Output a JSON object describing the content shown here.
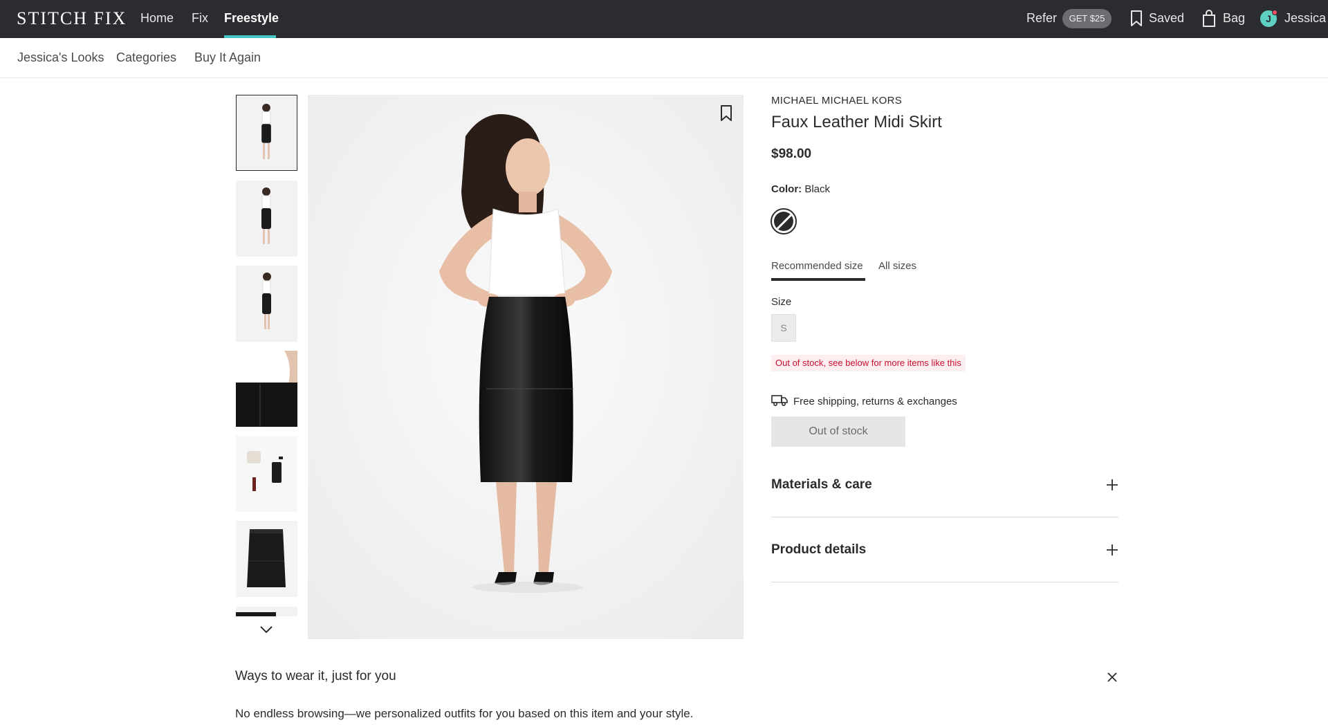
{
  "topnav": {
    "logo": "STITCH FIX",
    "links": [
      "Home",
      "Fix",
      "Freestyle"
    ],
    "active_link": "Freestyle",
    "refer_label": "Refer",
    "refer_badge": "GET $25",
    "saved_label": "Saved",
    "bag_label": "Bag",
    "user_initial": "J",
    "user_name": "Jessica"
  },
  "subnav": {
    "links": [
      "Jessica's Looks",
      "Categories",
      "Buy It Again"
    ]
  },
  "gallery": {
    "thumbnail_count": 6,
    "selected_index": 0
  },
  "product": {
    "brand": "MICHAEL MICHAEL KORS",
    "title": "Faux Leather Midi Skirt",
    "price": "$98.00",
    "color_label": "Color:",
    "color_value": "Black",
    "tabs": [
      "Recommended size",
      "All sizes"
    ],
    "size_label": "Size",
    "size_value": "S",
    "stock_note": "Out of stock, see below for more items like this",
    "shipping": "Free shipping, returns & exchanges",
    "button_label": "Out of stock",
    "accordions": [
      "Materials & care",
      "Product details"
    ]
  },
  "ways": {
    "title": "Ways to wear it, just for you",
    "description": "No endless browsing—we personalized outfits for you based on this item and your style."
  },
  "colors": {
    "nav_bg": "#2a2c30",
    "accent": "#46c6c2",
    "error": "#c8102e",
    "error_bg": "#fdeef0"
  }
}
